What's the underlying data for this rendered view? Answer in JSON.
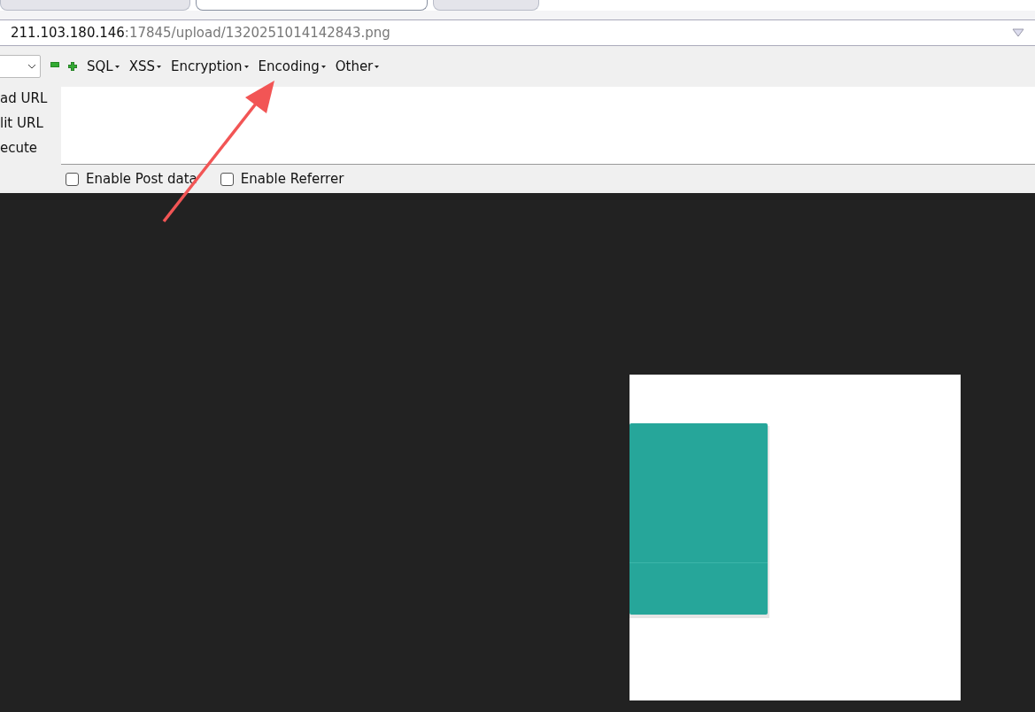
{
  "tabs": [
    {
      "selected": false
    },
    {
      "selected": true
    },
    {
      "selected": false
    }
  ],
  "address_bar": {
    "host": "211.103.180.146",
    "path": ":17845/upload/1320251014142843.png"
  },
  "hackbar": {
    "menus": [
      {
        "label": "SQL"
      },
      {
        "label": "XSS"
      },
      {
        "label": "Encryption"
      },
      {
        "label": "Encoding"
      },
      {
        "label": "Other"
      }
    ],
    "actions": [
      {
        "label": "ad URL"
      },
      {
        "label": "lit URL"
      },
      {
        "label": "ecute"
      }
    ],
    "options": [
      {
        "label": "Enable Post data",
        "checked": false
      },
      {
        "label": "Enable Referrer",
        "checked": false
      }
    ]
  }
}
